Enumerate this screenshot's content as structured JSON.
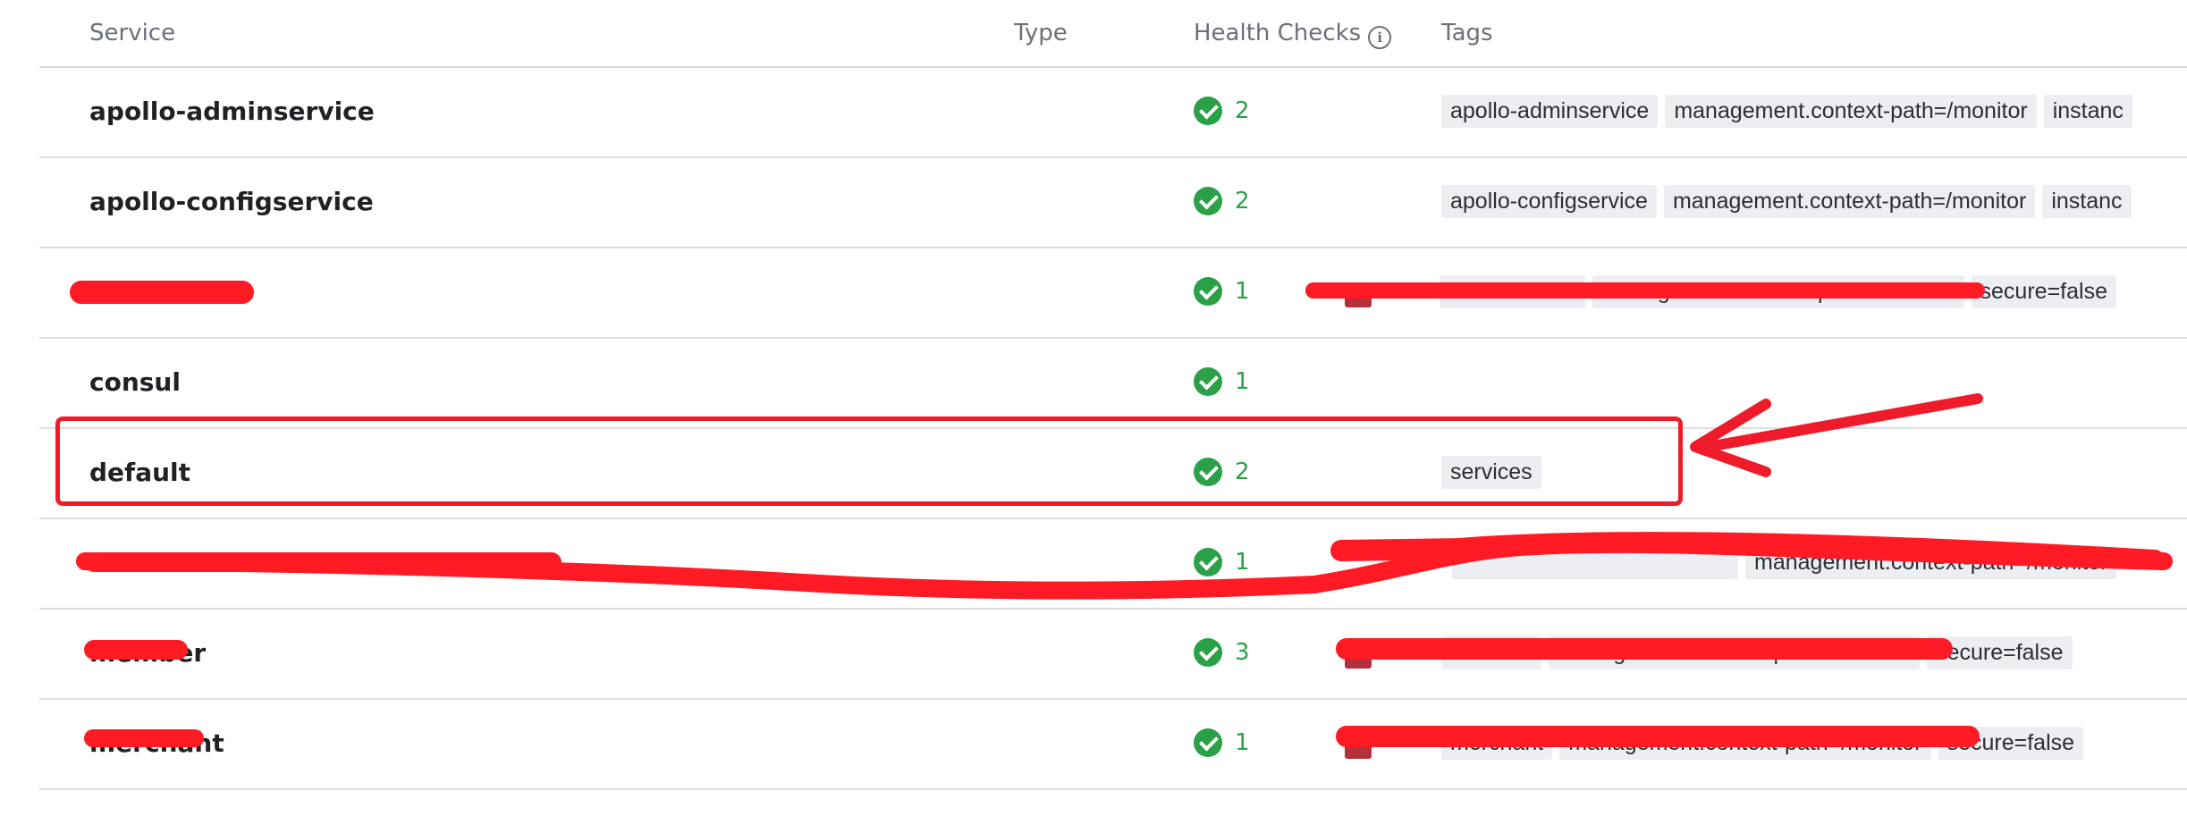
{
  "table": {
    "headers": {
      "service": "Service",
      "type": "Type",
      "health_checks": "Health Checks",
      "tags": "Tags"
    },
    "rows": [
      {
        "service": "apollo-adminservice",
        "health_count": "2",
        "tags": [
          "apollo-adminservice",
          "management.context-path=/monitor",
          "instanc"
        ]
      },
      {
        "service": "apollo-configservice",
        "health_count": "2",
        "tags": [
          "apollo-configservice",
          "management.context-path=/monitor",
          "instanc"
        ]
      },
      {
        "service": "",
        "health_count": "1",
        "tags": [
          "authorization",
          "management.context-path=/monitor",
          "secure=false"
        ]
      },
      {
        "service": "consul",
        "health_count": "1",
        "tags": []
      },
      {
        "service": "default",
        "health_count": "2",
        "tags": [
          "services"
        ]
      },
      {
        "service": "",
        "health_count": "1",
        "tags": [
          "",
          "management.context-path=/monitor"
        ]
      },
      {
        "service": "member",
        "health_count": "3",
        "tags": [
          "member",
          "management.context-path=/monitor",
          "secure=false"
        ]
      },
      {
        "service": "merchant",
        "health_count": "1",
        "tags": [
          "merchant",
          "management.context-path=/monitor",
          "secure=false"
        ]
      }
    ]
  },
  "colors": {
    "healthy": "#2aa146",
    "annotation": "#ee1c2a",
    "tag_bg": "#eceef2"
  },
  "icons": {
    "health": "check-circle-icon",
    "info": "info-icon"
  }
}
